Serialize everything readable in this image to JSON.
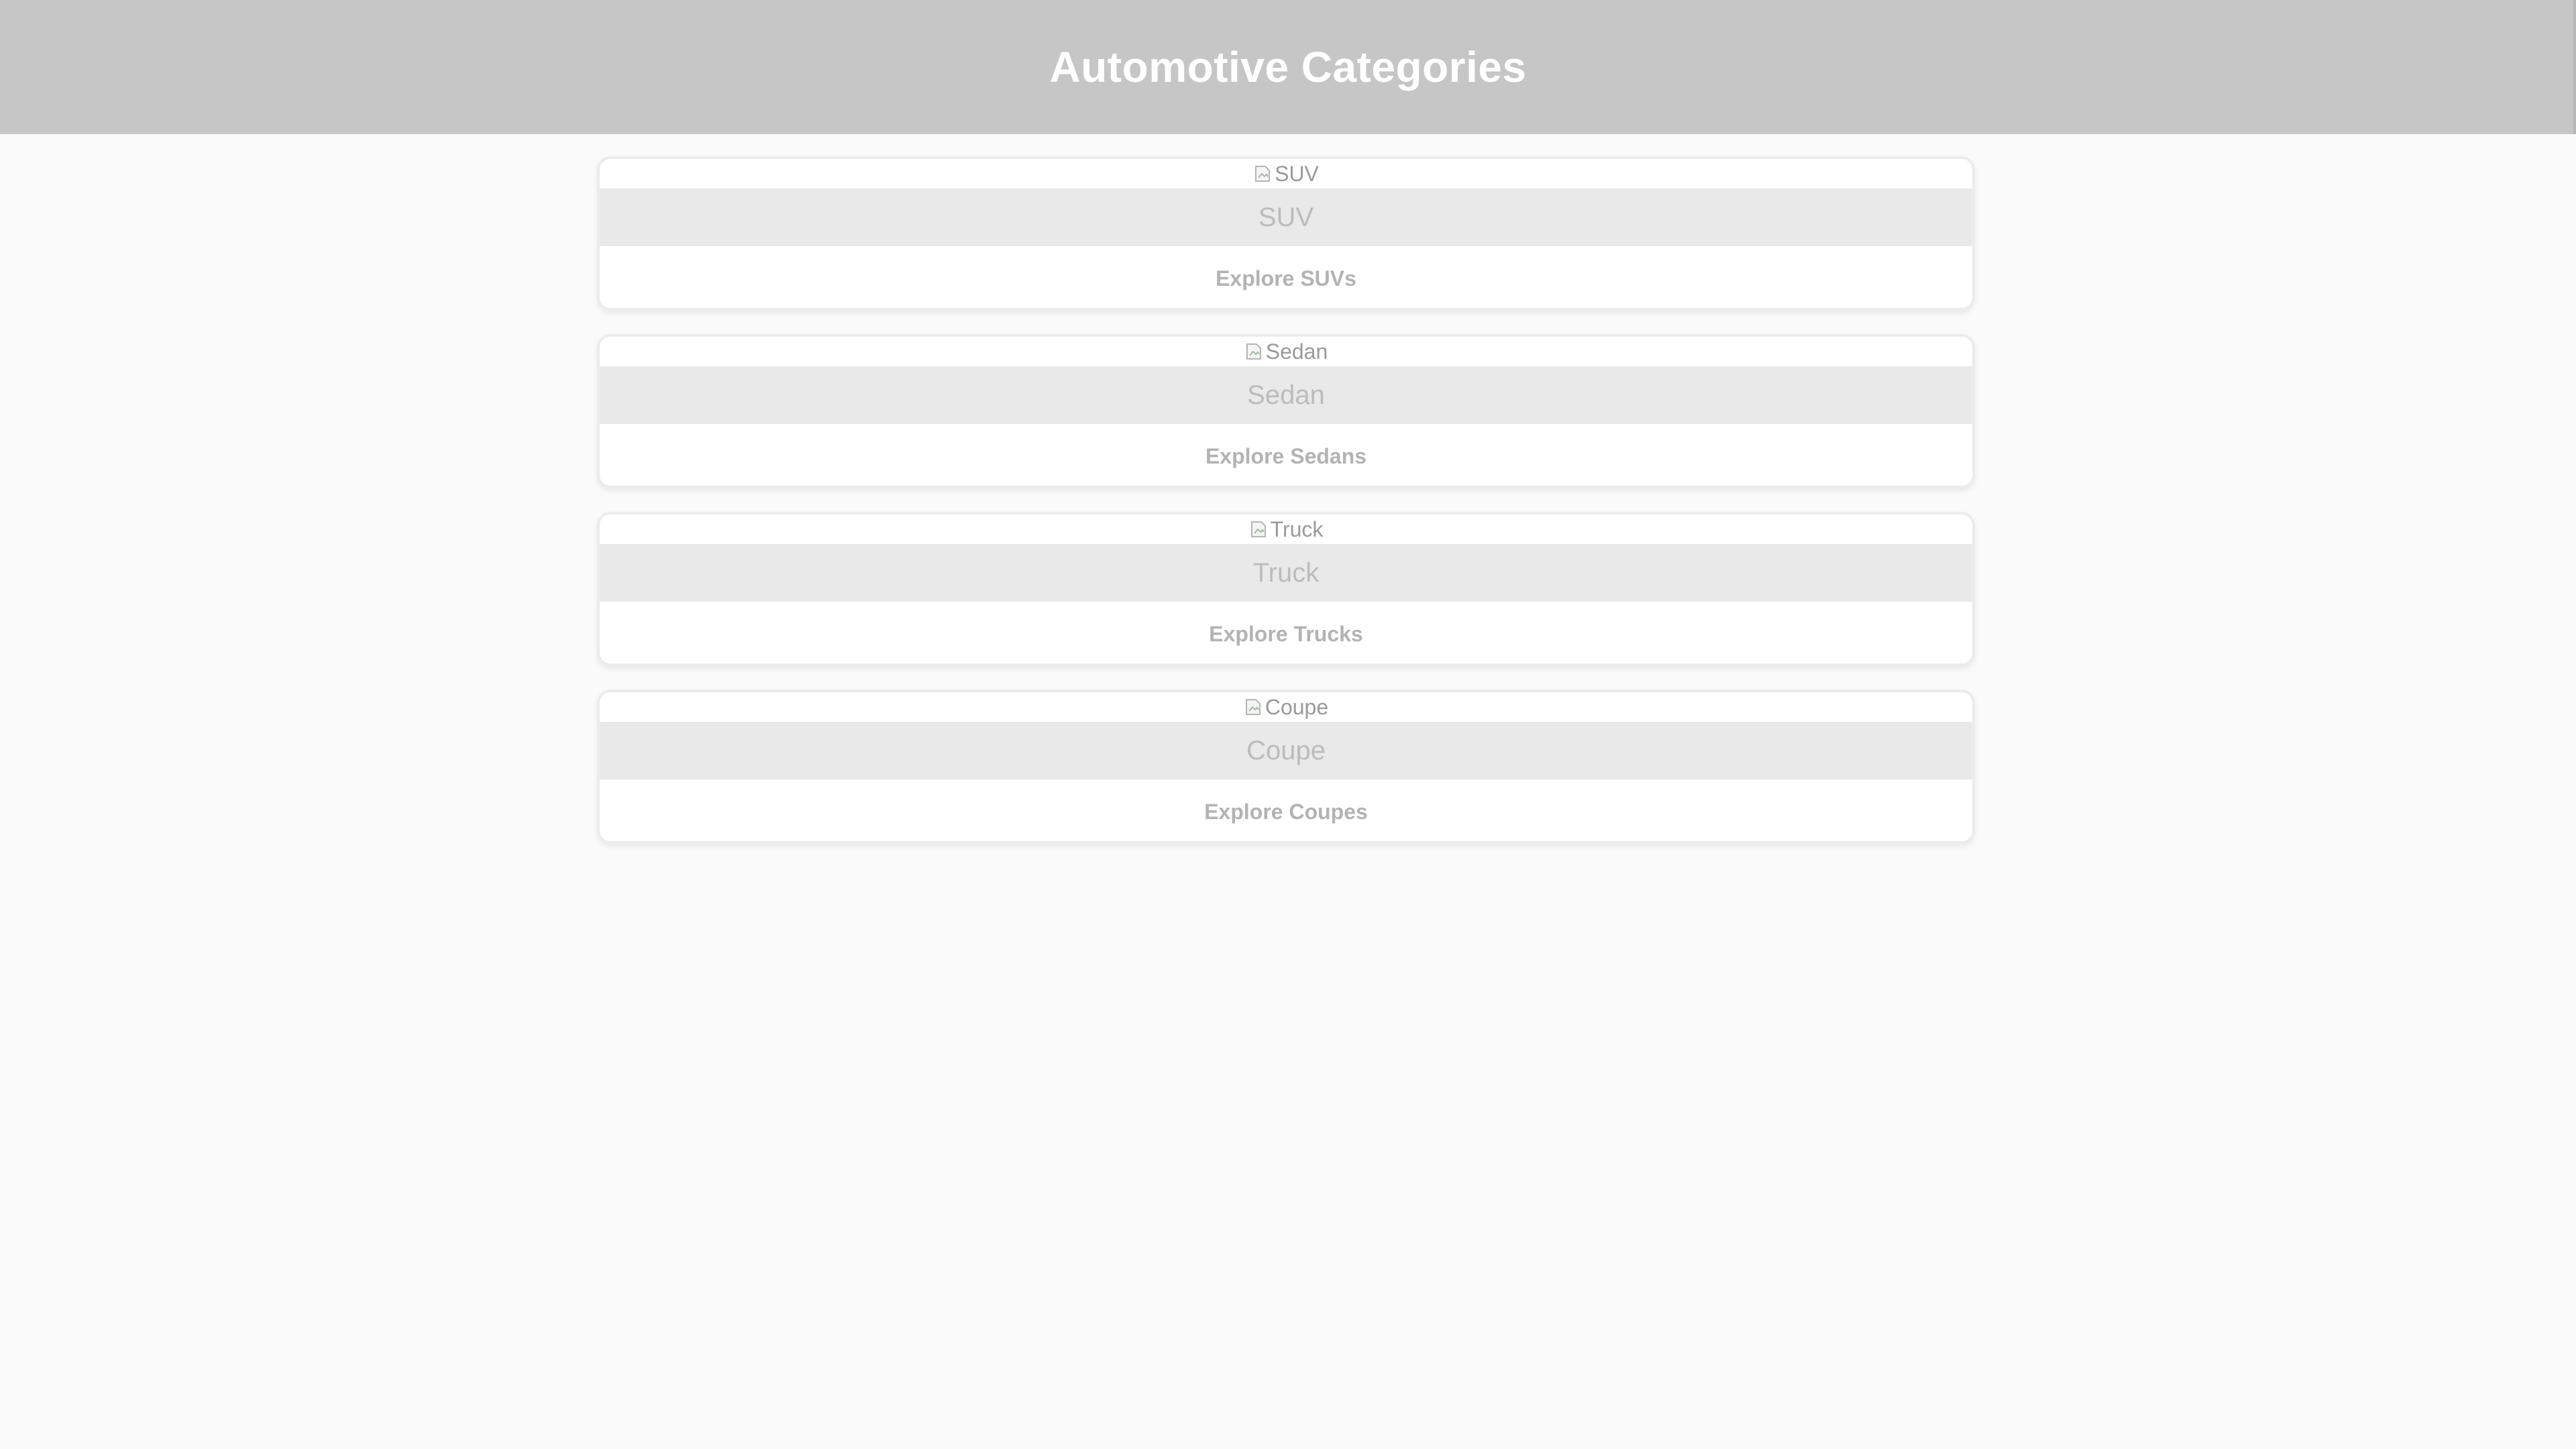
{
  "header": {
    "title": "Automotive Categories"
  },
  "categories": [
    {
      "image_alt": "SUV",
      "name": "SUV",
      "link_label": "Explore SUVs"
    },
    {
      "image_alt": "Sedan",
      "name": "Sedan",
      "link_label": "Explore Sedans"
    },
    {
      "image_alt": "Truck",
      "name": "Truck",
      "link_label": "Explore Trucks"
    },
    {
      "image_alt": "Coupe",
      "name": "Coupe",
      "link_label": "Explore Coupes"
    }
  ],
  "icons": {
    "image_placeholder": "broken-image-icon"
  },
  "colors": {
    "header_bg": "#c6c6c6",
    "page_bg": "#fafafa",
    "name_band_bg": "#e9e9e9"
  }
}
